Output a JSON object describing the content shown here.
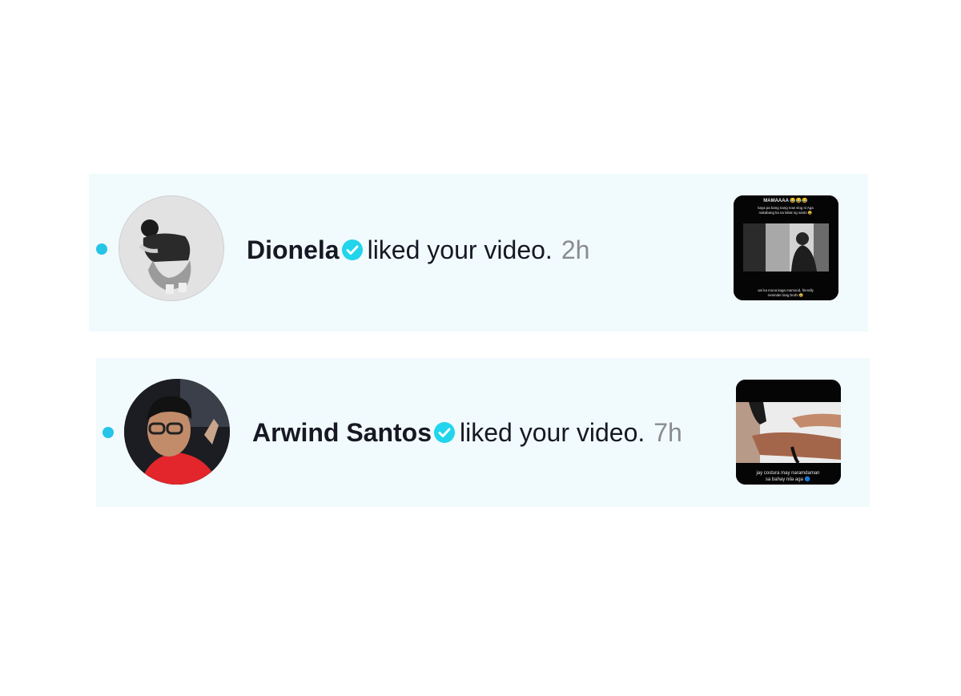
{
  "notifications": [
    {
      "username": "Dionela",
      "verified": true,
      "action": "liked your video.",
      "time": "2h",
      "unread": true,
      "thumbnail": {
        "top_caption_1": "MAMAAAA 😂😂😂",
        "top_caption_2": "kaya pa bang nang now vlog ni Aga",
        "top_caption_3": "nakabang ka na lahat ng santo 😅",
        "bottom_caption_1": "ani ka muna kaga mamood, friendly",
        "bottom_caption_2": "reminder lang bruh! 😅"
      }
    },
    {
      "username": "Arwind Santos",
      "verified": true,
      "action": "liked your video.",
      "time": "7h",
      "unread": true,
      "thumbnail": {
        "bottom_caption_1": "jay costura may naramdaman",
        "bottom_caption_2": "sa bahay nila aga 🔵"
      }
    }
  ],
  "colors": {
    "row_background": "#f1fafd",
    "unread_dot": "#25c4e8",
    "verified_badge": "#20d5ec",
    "time_text": "#8a8b91"
  }
}
